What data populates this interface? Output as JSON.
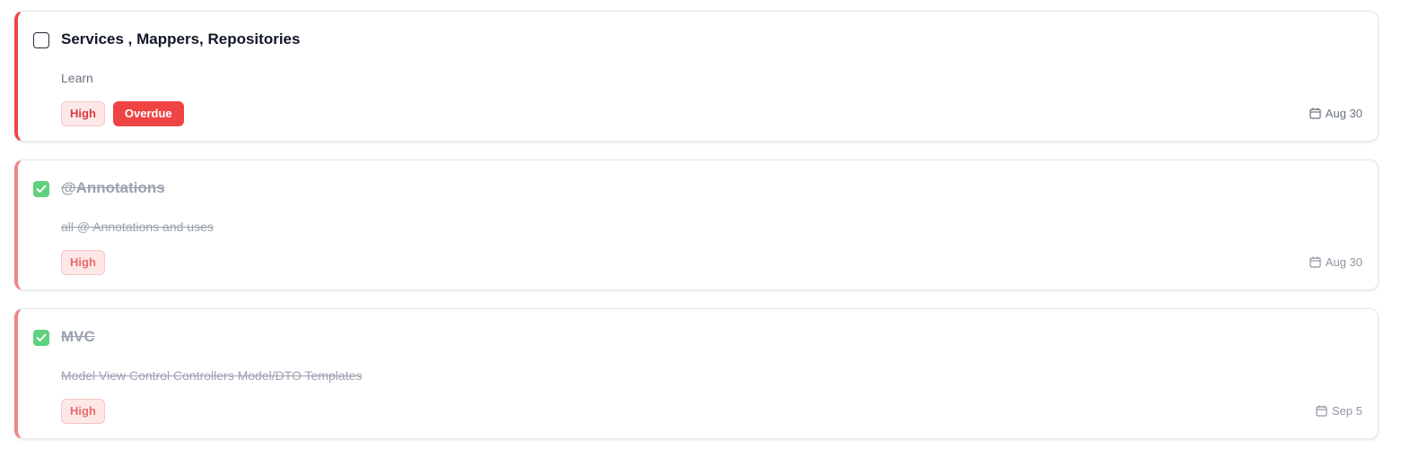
{
  "tasks": [
    {
      "title": "Services , Mappers, Repositories",
      "description": "Learn",
      "priority": "High",
      "status_badge": "Overdue",
      "due_date": "Aug 30",
      "completed": false
    },
    {
      "title": "@Annotations",
      "description": "all @ Annotations and uses",
      "priority": "High",
      "due_date": "Aug 30",
      "completed": true
    },
    {
      "title": "MVC",
      "description": "Model View Control Controllers Model/DTO Templates",
      "priority": "High",
      "due_date": "Sep 5",
      "completed": true
    }
  ],
  "icons": {
    "checkbox_checked": "check-icon",
    "due_date": "calendar-icon"
  },
  "colors": {
    "priority_high_border": "#ef4444",
    "overdue_badge": "#ef4444",
    "checked": "#5fd07d"
  }
}
